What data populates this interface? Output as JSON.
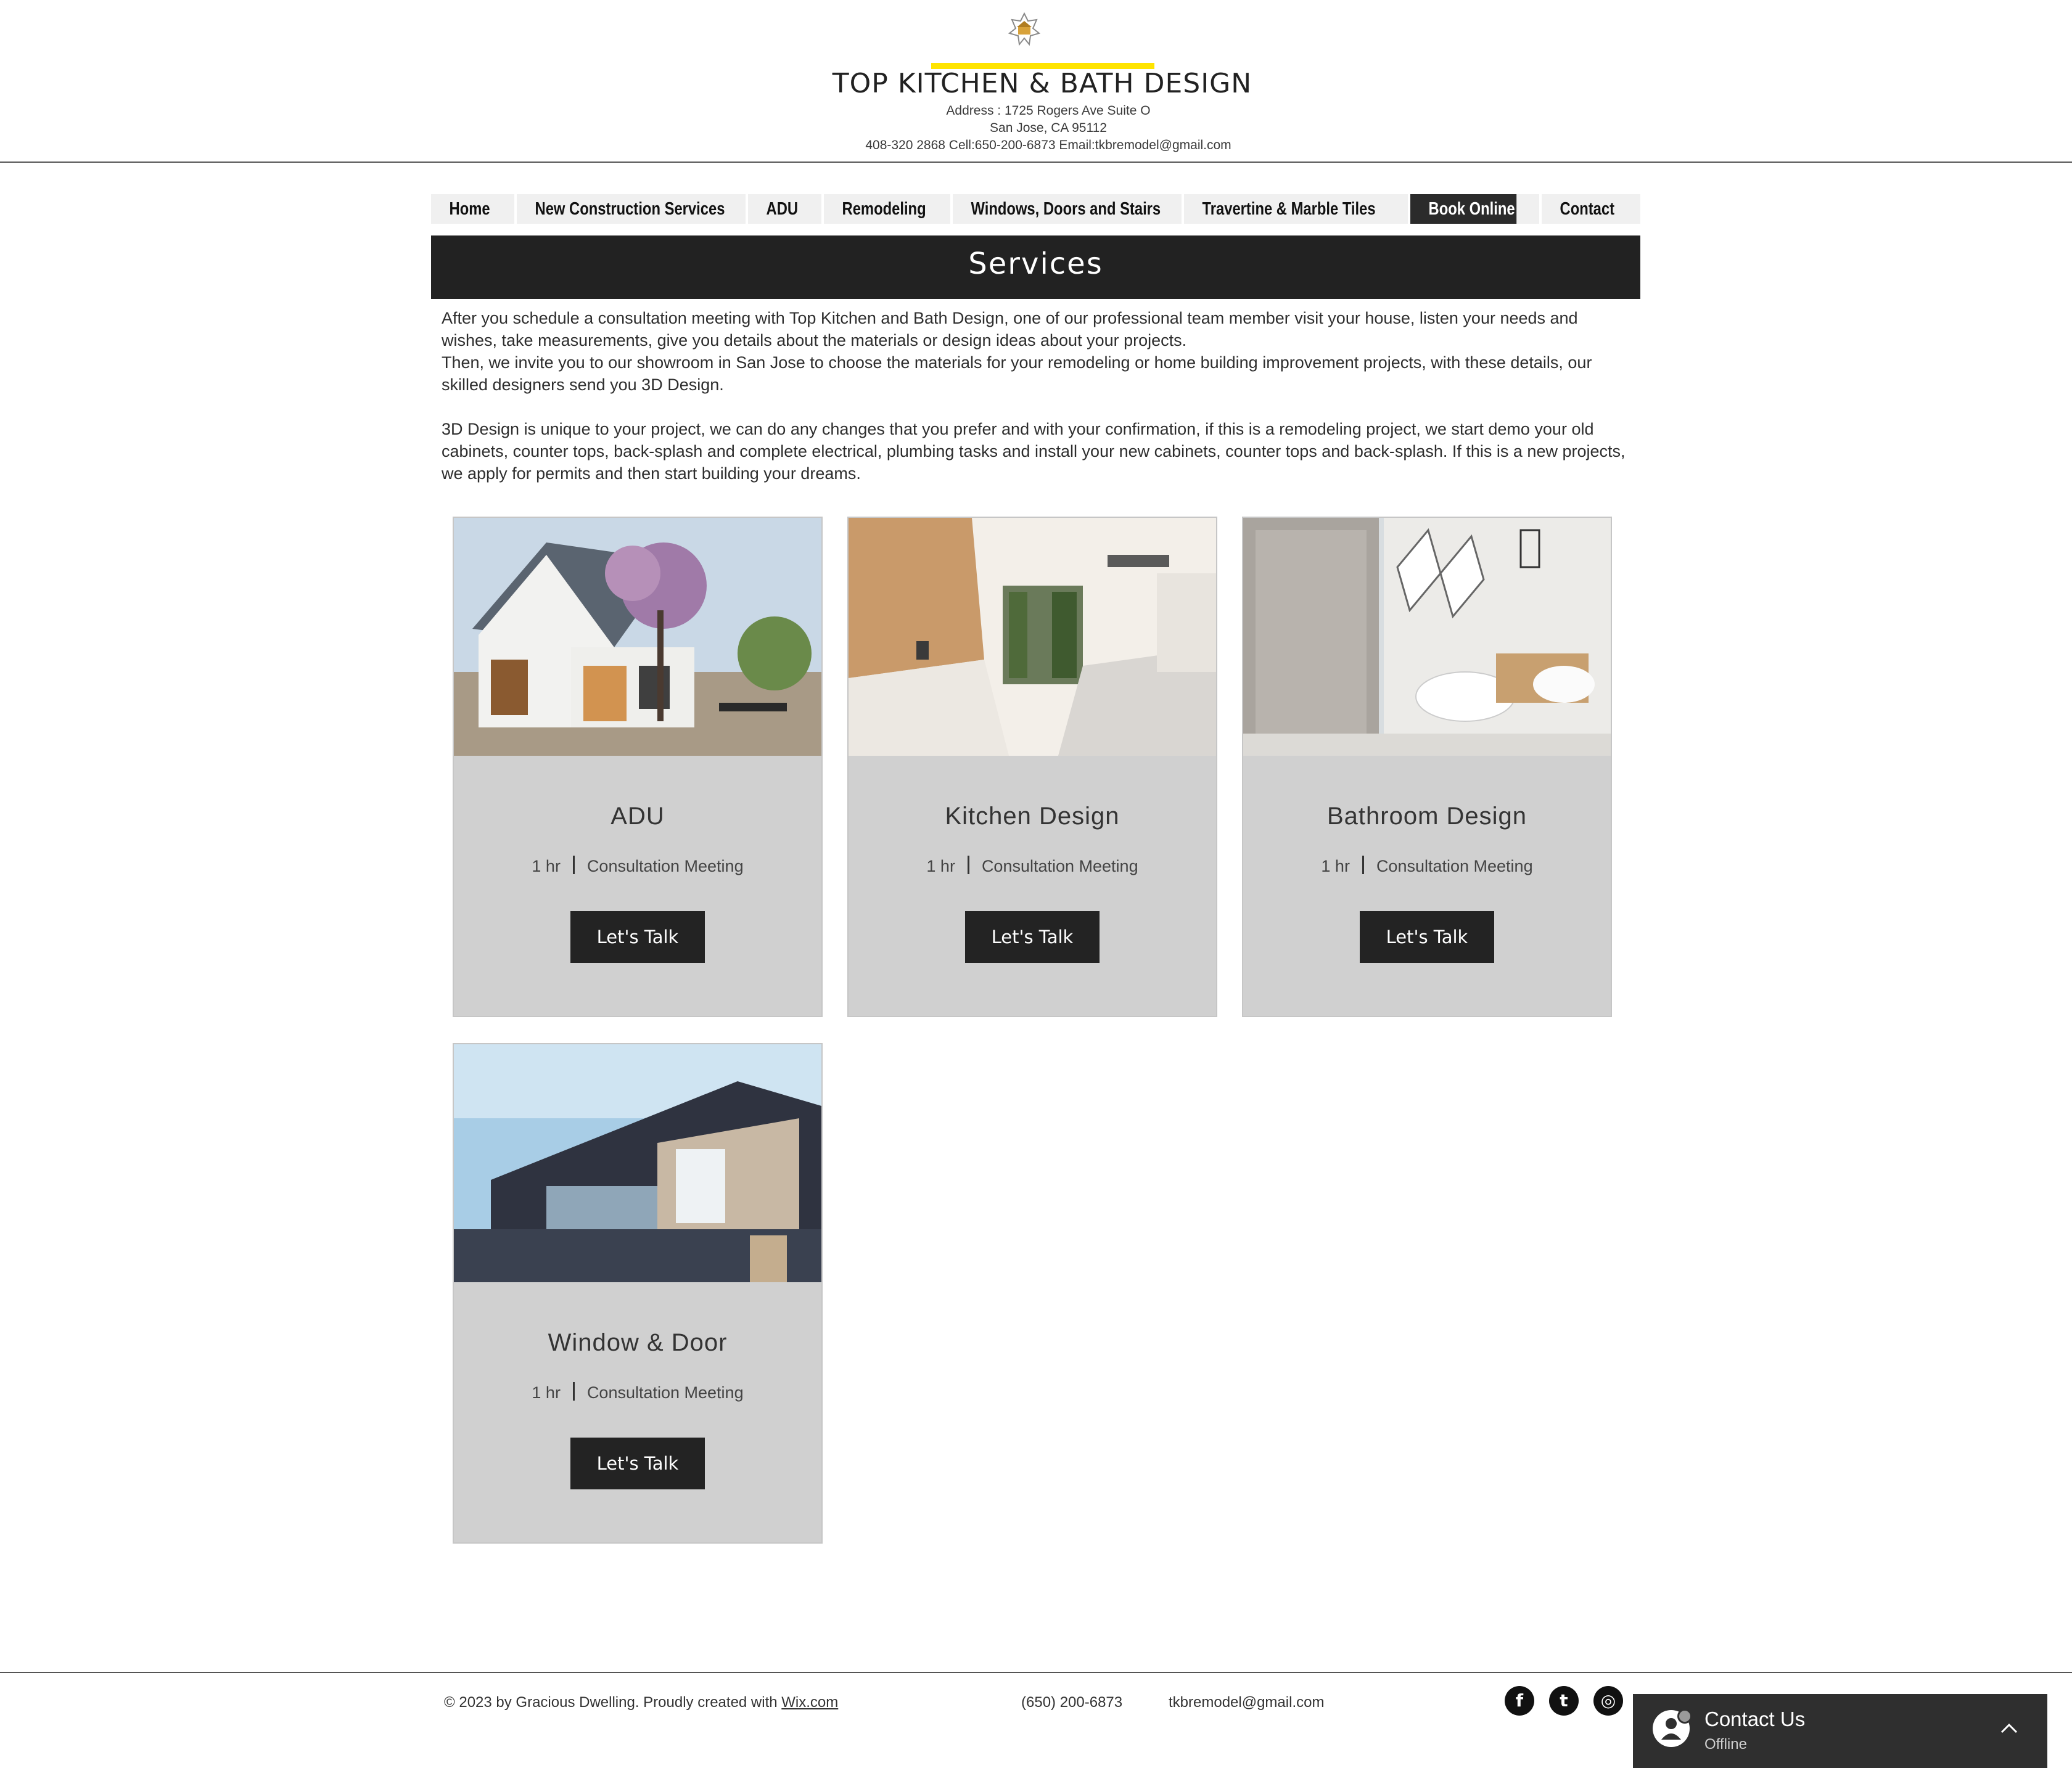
{
  "header": {
    "logo_icon": "house-star-logo-icon",
    "accent_color": "#ffe400",
    "title": "TOP KITCHEN & BATH DESIGN",
    "address_line1": "Address : 1725 Rogers Ave Suite O",
    "address_line2": "San Jose, CA 95112",
    "address_line3": "408-320 2868 Cell:650-200-6873 Email:tkbremodel@gmail.com"
  },
  "nav": {
    "items": [
      {
        "label": "Home"
      },
      {
        "label": "New Construction Services"
      },
      {
        "label": "ADU"
      },
      {
        "label": "Remodeling"
      },
      {
        "label": "Windows, Doors and Stairs"
      },
      {
        "label": "Travertine & Marble Tiles"
      },
      {
        "label": "Book Online",
        "active": true
      },
      {
        "label": "Contact"
      }
    ]
  },
  "main": {
    "section_title": "Services",
    "intro_p1": "After you schedule a consultation meeting with Top Kitchen and Bath Design, one of our professional team member visit your house, listen your needs and wishes, take measurements, give you details about the materials or design ideas about your projects.",
    "intro_p2": "Then, we invite you to our showroom in San Jose to choose the materials for your remodeling or home building improvement projects, with these details, our skilled designers send you 3D Design.",
    "intro_p3": "3D Design is unique to your project, we can do any changes that you prefer and with your confirmation, if this is a remodeling project, we start demo your old cabinets, counter tops, back-splash and complete electrical, plumbing tasks and install your new cabinets, counter tops and back-splash. If this is a new projects, we apply for permits and then start building your dreams.",
    "services": [
      {
        "title": "ADU",
        "duration": "1 hr",
        "type": "Consultation Meeting",
        "button": "Let's Talk"
      },
      {
        "title": "Kitchen Design",
        "duration": "1 hr",
        "type": "Consultation Meeting",
        "button": "Let's Talk"
      },
      {
        "title": "Bathroom Design",
        "duration": "1 hr",
        "type": "Consultation Meeting",
        "button": "Let's Talk"
      },
      {
        "title": "Window & Door",
        "duration": "1 hr",
        "type": "Consultation Meeting",
        "button": "Let's Talk"
      }
    ]
  },
  "footer": {
    "copyright": "© 2023 by Gracious Dwelling. Proudly created with ",
    "wix_link": "Wix.com",
    "phone": "(650) 200-6873",
    "email": "tkbremodel@gmail.com",
    "social": [
      {
        "icon": "facebook-icon",
        "glyph": "f"
      },
      {
        "icon": "twitter-icon",
        "glyph": "t"
      },
      {
        "icon": "instagram-icon",
        "glyph": "◎"
      }
    ]
  },
  "chat": {
    "title": "Contact Us",
    "status": "Offline"
  }
}
